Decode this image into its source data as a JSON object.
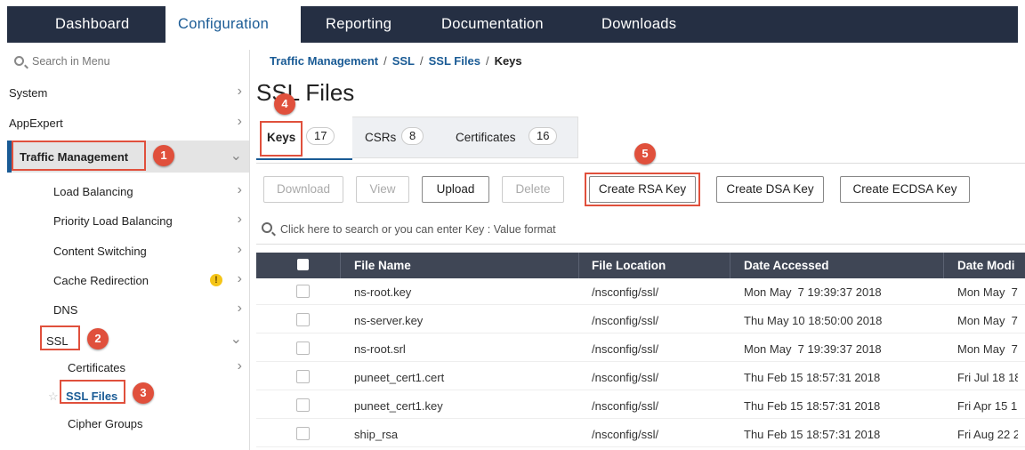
{
  "nav": {
    "tabs": [
      {
        "label": "Dashboard"
      },
      {
        "label": "Configuration"
      },
      {
        "label": "Reporting"
      },
      {
        "label": "Documentation"
      },
      {
        "label": "Downloads"
      }
    ],
    "active_tab": "Configuration"
  },
  "sidebar": {
    "search_placeholder": "Search in Menu",
    "items": [
      {
        "label": "System"
      },
      {
        "label": "AppExpert"
      },
      {
        "label": "Traffic Management"
      },
      {
        "label": "Load Balancing"
      },
      {
        "label": "Priority Load Balancing"
      },
      {
        "label": "Content Switching"
      },
      {
        "label": "Cache Redirection"
      },
      {
        "label": "DNS"
      },
      {
        "label": "SSL"
      },
      {
        "label": "Certificates"
      },
      {
        "label": "SSL Files"
      },
      {
        "label": "Cipher Groups"
      }
    ],
    "warn_glyph": "!"
  },
  "breadcrumb": {
    "items": [
      "Traffic Management",
      "SSL",
      "SSL Files",
      "Keys"
    ],
    "separator": "/"
  },
  "page": {
    "title": "SSL Files",
    "tabs": [
      {
        "label": "Keys",
        "count": "17"
      },
      {
        "label": "CSRs",
        "count": "8"
      },
      {
        "label": "Certificates",
        "count": "16"
      }
    ],
    "active_tab": "Keys"
  },
  "toolbar": {
    "download": "Download",
    "view": "View",
    "upload": "Upload",
    "delete": "Delete",
    "create_rsa": "Create RSA Key",
    "create_dsa": "Create DSA Key",
    "create_ecdsa": "Create ECDSA Key"
  },
  "table": {
    "search_placeholder": "Click here to search or you can enter Key : Value format",
    "columns": [
      "File Name",
      "File Location",
      "Date Accessed",
      "Date Modi"
    ],
    "rows": [
      {
        "name": "ns-root.key",
        "location": "/nsconfig/ssl/",
        "accessed": "Mon May  7 19:39:37 2018",
        "modified": "Mon May  7"
      },
      {
        "name": "ns-server.key",
        "location": "/nsconfig/ssl/",
        "accessed": "Thu May 10 18:50:00 2018",
        "modified": "Mon May  7"
      },
      {
        "name": "ns-root.srl",
        "location": "/nsconfig/ssl/",
        "accessed": "Mon May  7 19:39:37 2018",
        "modified": "Mon May  7"
      },
      {
        "name": "puneet_cert1.cert",
        "location": "/nsconfig/ssl/",
        "accessed": "Thu Feb 15 18:57:31 2018",
        "modified": "Fri Jul 18 18"
      },
      {
        "name": "puneet_cert1.key",
        "location": "/nsconfig/ssl/",
        "accessed": "Thu Feb 15 18:57:31 2018",
        "modified": "Fri Apr 15 1"
      },
      {
        "name": "ship_rsa",
        "location": "/nsconfig/ssl/",
        "accessed": "Thu Feb 15 18:57:31 2018",
        "modified": "Fri Aug 22 2"
      }
    ]
  },
  "annotations": [
    "1",
    "2",
    "3",
    "4",
    "5"
  ],
  "colors": {
    "nav_bg": "#252f43",
    "accent": "#1a5b95",
    "annotation": "#e0503c",
    "table_header": "#3f4655"
  }
}
